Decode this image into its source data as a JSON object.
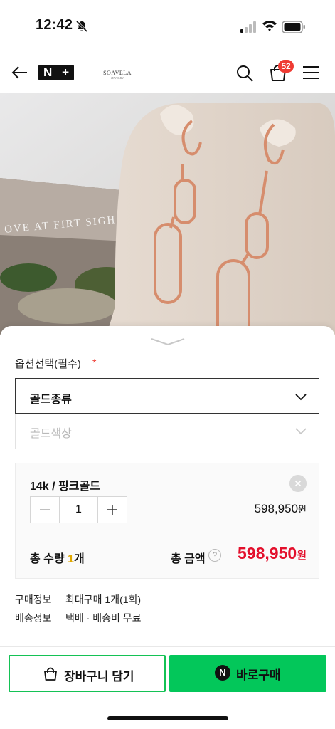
{
  "status_bar": {
    "time": "12:42"
  },
  "header": {
    "nplus_left": "N",
    "nplus_right": "+",
    "brand_name": "SOAVELA",
    "brand_sub": "JEWELRY",
    "cart_count": "52"
  },
  "photo": {
    "overlay_text": "OVE AT FIRT SIGH"
  },
  "options": {
    "label": "옵션선택(필수)",
    "required_mark": "*",
    "select1": "골드종류",
    "select2_placeholder": "골드색상"
  },
  "selected": {
    "name": "14k / 핑크골드",
    "quantity": "1",
    "price": "598,950",
    "currency": "원"
  },
  "totals": {
    "qty_prefix": "총 수량 ",
    "qty_num": "1",
    "qty_suffix": "개",
    "amount_label": "총 금액",
    "help_mark": "?",
    "amount": "598,950",
    "currency": "원"
  },
  "info": [
    {
      "key": "구매정보",
      "value": "최대구매 1개(1회)"
    },
    {
      "key": "배송정보",
      "value": "택배 · 배송비 무료"
    }
  ],
  "actions": {
    "cart_label": "장바구니 담기",
    "buy_icon": "N",
    "buy_label": "바로구매"
  },
  "colors": {
    "accent_green": "#03c75a",
    "price_red": "#e3102c",
    "badge_red": "#ef3b33"
  }
}
